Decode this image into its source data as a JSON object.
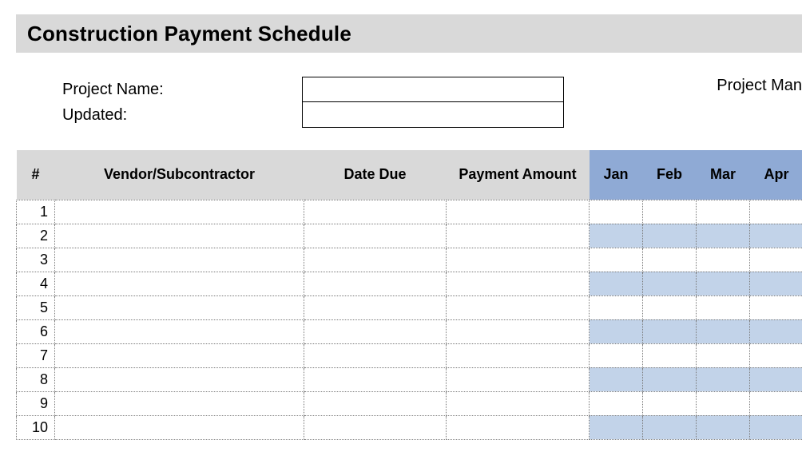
{
  "title": "Construction Payment Schedule",
  "meta": {
    "project_name_label": "Project Name:",
    "updated_label": "Updated:",
    "project_manager_label_truncated": "Project Man",
    "project_name_value": "",
    "updated_value": ""
  },
  "columns": {
    "index": "#",
    "vendor": "Vendor/Subcontractor",
    "date_due": "Date Due",
    "payment_amount": "Payment Amount",
    "months": [
      "Jan",
      "Feb",
      "Mar",
      "Apr"
    ]
  },
  "rows": [
    {
      "n": "1",
      "vendor": "",
      "date_due": "",
      "amount": "",
      "jan": "",
      "feb": "",
      "mar": "",
      "apr": ""
    },
    {
      "n": "2",
      "vendor": "",
      "date_due": "",
      "amount": "",
      "jan": "",
      "feb": "",
      "mar": "",
      "apr": ""
    },
    {
      "n": "3",
      "vendor": "",
      "date_due": "",
      "amount": "",
      "jan": "",
      "feb": "",
      "mar": "",
      "apr": ""
    },
    {
      "n": "4",
      "vendor": "",
      "date_due": "",
      "amount": "",
      "jan": "",
      "feb": "",
      "mar": "",
      "apr": ""
    },
    {
      "n": "5",
      "vendor": "",
      "date_due": "",
      "amount": "",
      "jan": "",
      "feb": "",
      "mar": "",
      "apr": ""
    },
    {
      "n": "6",
      "vendor": "",
      "date_due": "",
      "amount": "",
      "jan": "",
      "feb": "",
      "mar": "",
      "apr": ""
    },
    {
      "n": "7",
      "vendor": "",
      "date_due": "",
      "amount": "",
      "jan": "",
      "feb": "",
      "mar": "",
      "apr": ""
    },
    {
      "n": "8",
      "vendor": "",
      "date_due": "",
      "amount": "",
      "jan": "",
      "feb": "",
      "mar": "",
      "apr": ""
    },
    {
      "n": "9",
      "vendor": "",
      "date_due": "",
      "amount": "",
      "jan": "",
      "feb": "",
      "mar": "",
      "apr": ""
    },
    {
      "n": "10",
      "vendor": "",
      "date_due": "",
      "amount": "",
      "jan": "",
      "feb": "",
      "mar": "",
      "apr": ""
    }
  ]
}
